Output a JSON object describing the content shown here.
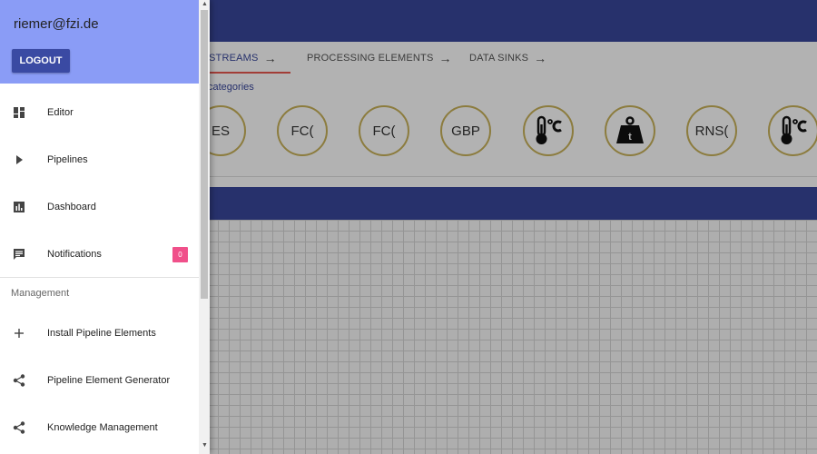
{
  "header": {
    "tabs": [
      {
        "label": "STREAMS"
      },
      {
        "label": "PROCESSING ELEMENTS"
      },
      {
        "label": "DATA SINKS"
      }
    ]
  },
  "categories": {
    "link_label": "categories",
    "elements": [
      {
        "label": "ES"
      },
      {
        "label": "FC("
      },
      {
        "label": "FC("
      },
      {
        "label": "GBP"
      },
      {
        "label": "",
        "icon": "thermometer-celsius-icon"
      },
      {
        "label": "",
        "icon": "weight-icon",
        "icon_text": "t"
      },
      {
        "label": "RNS("
      },
      {
        "label": "",
        "icon": "thermometer-celsius-icon"
      }
    ]
  },
  "drawer": {
    "user_email": "riemer@fzi.de",
    "logout_label": "LOGOUT",
    "nav_items": [
      {
        "label": "Editor",
        "icon": "dashboard-icon"
      },
      {
        "label": "Pipelines",
        "icon": "play-icon"
      },
      {
        "label": "Dashboard",
        "icon": "bar-chart-icon"
      },
      {
        "label": "Notifications",
        "icon": "message-icon",
        "badge": "0"
      }
    ],
    "section_label": "Management",
    "management_items": [
      {
        "label": "Install Pipeline Elements",
        "icon": "plus-icon"
      },
      {
        "label": "Pipeline Element Generator",
        "icon": "share-icon"
      },
      {
        "label": "Knowledge Management",
        "icon": "share-icon"
      }
    ]
  },
  "colors": {
    "primary": "#39479b",
    "drawer_header": "#8a9cf6",
    "badge": "#f0508a",
    "accent_underline": "#e8584f"
  }
}
